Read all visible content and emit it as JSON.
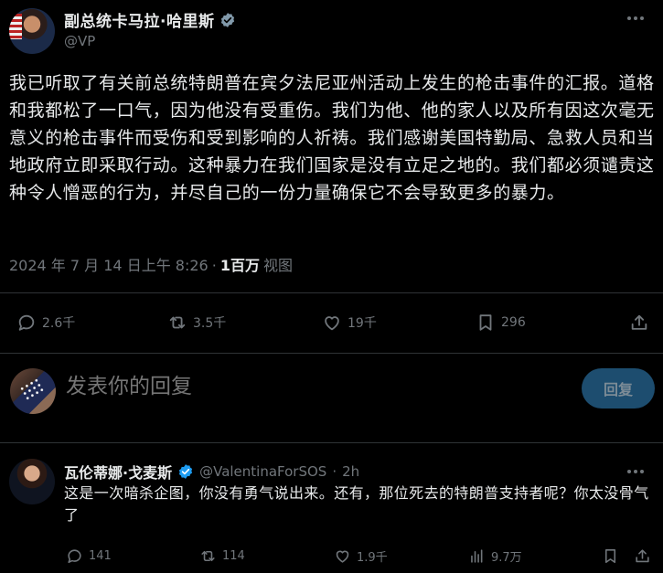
{
  "post": {
    "author_name": "副总统卡马拉·哈里斯",
    "author_handle": "@VP",
    "text": "我已听取了有关前总统特朗普在宾夕法尼亚州活动上发生的枪击事件的汇报。道格和我都松了一口气，因为他没有受重伤。我们为他、他的家人以及所有因这次毫无意义的枪击事件而受伤和受到影响的人祈祷。我们感谢美国特勤局、急救人员和当地政府立即采取行动。这种暴力在我们国家是没有立足之地的。我们都必须谴责这种令人憎恶的行为，并尽自己的一份力量确保它不会导致更多的暴力。",
    "timestamp": "2024 年 7 月 14 日上午 8:26",
    "separator": "·",
    "views_count": "1百万",
    "views_label": "视图",
    "actions": {
      "replies": "2.6千",
      "reposts": "3.5千",
      "likes": "19千",
      "bookmarks": "296"
    }
  },
  "compose": {
    "placeholder": "发表你的回复",
    "button_label": "回复"
  },
  "reply": {
    "author_name": "瓦伦蒂娜·戈麦斯",
    "author_handle": "@ValentinaForSOS",
    "separator": "·",
    "time": "2h",
    "text": "这是一次暗杀企图，你没有勇气说出来。还有，那位死去的特朗普支持者呢？你太没骨气了",
    "actions": {
      "replies": "141",
      "reposts": "114",
      "likes": "1.9千",
      "views": "9.7万"
    }
  },
  "colors": {
    "background": "#000000",
    "text": "#e7e9ea",
    "muted": "#71767b",
    "verified_blue": "#1d9bf0",
    "verified_grey": "#829aab",
    "reply_button_bg": "#1d4d6f"
  }
}
